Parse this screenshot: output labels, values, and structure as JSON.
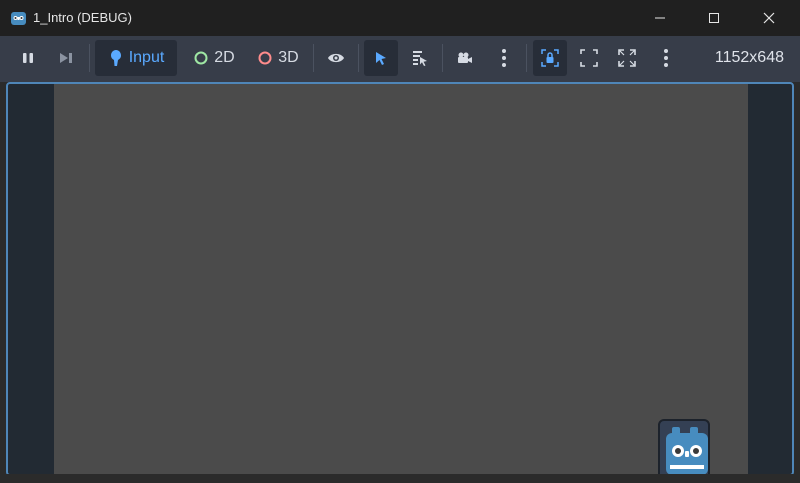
{
  "window": {
    "title": "1_Intro (DEBUG)",
    "controls": [
      "minimize",
      "maximize",
      "close"
    ]
  },
  "toolbar": {
    "pause_icon": "pause-icon",
    "next_frame_icon": "next-frame-icon",
    "input_label": "Input",
    "mode_2d_label": "2D",
    "mode_3d_label": "3D",
    "resolution": "1152x648",
    "colors": {
      "accent": "#5aa9ff",
      "mode_2d": "#9fe7a4",
      "mode_3d": "#ff8c8c"
    }
  }
}
